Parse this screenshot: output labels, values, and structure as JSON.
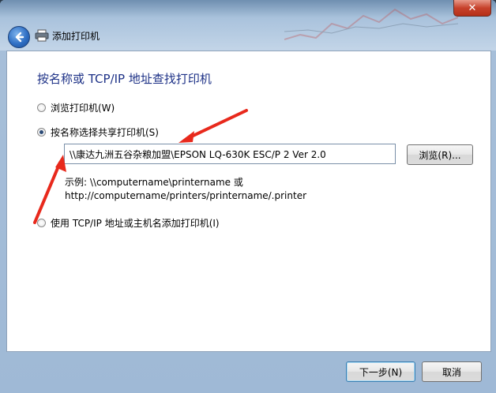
{
  "window": {
    "title": "添加打印机",
    "close_glyph": "✕",
    "back_icon": "back-arrow-icon",
    "printer_icon": "printer-icon"
  },
  "main": {
    "heading": "按名称或 TCP/IP 地址查找打印机",
    "options": [
      {
        "label": "浏览打印机(W)",
        "checked": false
      },
      {
        "label": "按名称选择共享打印机(S)",
        "checked": true
      },
      {
        "label": "使用 TCP/IP 地址或主机名添加打印机(I)",
        "checked": false
      }
    ],
    "share_path_value": "\\\\康达九洲五谷杂粮加盟\\EPSON LQ-630K ESC/P 2 Ver 2.0",
    "browse_button": "浏览(R)...",
    "example_line1": "示例: \\\\computername\\printername 或",
    "example_line2": "http://computername/printers/printername/.printer"
  },
  "footer": {
    "next_button": "下一步(N)",
    "cancel_button": "取消"
  },
  "colors": {
    "heading": "#1e3287",
    "annotation_arrow": "#e8291c"
  }
}
